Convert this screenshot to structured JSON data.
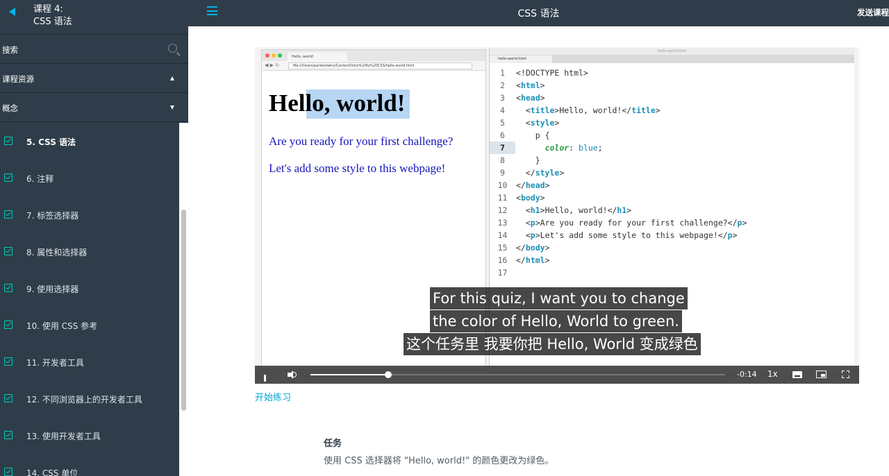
{
  "sidebar": {
    "course_num": "课程 4:",
    "course_title": "CSS 语法",
    "search_label": "搜索",
    "resources_label": "课程资源",
    "concepts_label": "概念",
    "lessons": [
      {
        "label": "5. CSS 语法",
        "active": true
      },
      {
        "label": "6. 注释"
      },
      {
        "label": "7. 标签选择器"
      },
      {
        "label": "8. 属性和选择器"
      },
      {
        "label": "9. 使用选择器"
      },
      {
        "label": "10. 使用 CSS 参考"
      },
      {
        "label": "11. 开发者工具"
      },
      {
        "label": "12. 不同浏览器上的开发者工具"
      },
      {
        "label": "13. 使用开发者工具"
      },
      {
        "label": "14. CSS 单位"
      }
    ]
  },
  "topbar": {
    "title": "CSS 语法",
    "send_label": "发送课程"
  },
  "video": {
    "browser_tab": "Hello, world!",
    "browser_url": "file:///Users/parkestwins/Content/Intro%20to%20CSS/hello-world.html",
    "page_h1": "Hello, world!",
    "page_p1": "Are you ready for your first challenge?",
    "page_p2": "Let's add some style to this webpage!",
    "editor_title": "hello-world.html",
    "editor_tab": "hello-world.html",
    "line_numbers": [
      "1",
      "2",
      "3",
      "4",
      "5",
      "6",
      "7",
      "8",
      "9",
      "10",
      "11",
      "12",
      "13",
      "14",
      "15",
      "16",
      "17"
    ],
    "highlighted_line": 7,
    "captions": [
      "For this quiz, I want you to change",
      "the color of Hello, World to green.",
      "这个任务里 我要你把 Hello, World 变成绿色"
    ],
    "progress": 0.188,
    "time_remaining": "-0:14",
    "speed": "1x"
  },
  "practice_link": "开始练习",
  "task": {
    "title": "任务",
    "body": "使用 CSS 选择器将 \"Hello, world!\" 的颜色更改为绿色。"
  },
  "colors": {
    "sidebar_bg": "#2e3d49",
    "accent": "#02b3e4",
    "check": "#02ccba"
  }
}
